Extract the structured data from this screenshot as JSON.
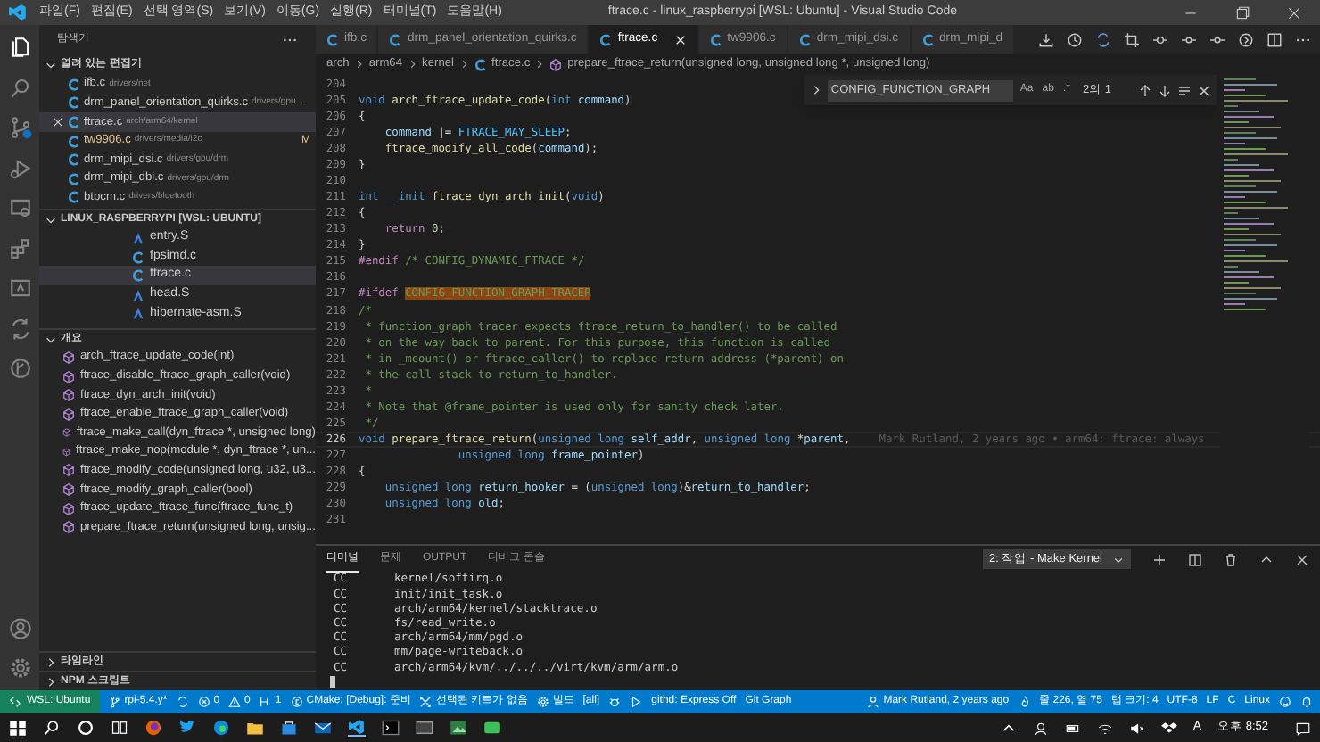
{
  "window": {
    "title": "ftrace.c - linux_raspberrypi [WSL: Ubuntu] - Visual Studio Code"
  },
  "menu": [
    "파일(F)",
    "편집(E)",
    "선택 영역(S)",
    "보기(V)",
    "이동(G)",
    "실행(R)",
    "터미널(T)",
    "도움말(H)"
  ],
  "sidebar": {
    "title": "탐색기",
    "open_editors": {
      "title": "열려 있는 편집기",
      "expanded": true,
      "items": [
        {
          "name": "ifb.c",
          "path": "drivers/net",
          "selected": false,
          "modified": false
        },
        {
          "name": "drm_panel_orientation_quirks.c",
          "path": "drivers/gpu...",
          "selected": false,
          "modified": false
        },
        {
          "name": "ftrace.c",
          "path": "arch/arm64/kernel",
          "selected": true,
          "modified": false
        },
        {
          "name": "tw9906.c",
          "path": "drivers/media/i2c",
          "selected": false,
          "modified": true,
          "badge": "M"
        },
        {
          "name": "drm_mipi_dsi.c",
          "path": "drivers/gpu/drm",
          "selected": false,
          "modified": false
        },
        {
          "name": "drm_mipi_dbi.c",
          "path": "drivers/gpu/drm",
          "selected": false,
          "modified": false
        },
        {
          "name": "btbcm.c",
          "path": "drivers/bluetooth",
          "selected": false,
          "modified": false
        }
      ]
    },
    "project": {
      "title": "LINUX_RASPBERRYPI [WSL: UBUNTU]",
      "expanded": true,
      "items": [
        {
          "name": "entry.S",
          "kind": "asm",
          "selected": false
        },
        {
          "name": "fpsimd.c",
          "kind": "c",
          "selected": false
        },
        {
          "name": "ftrace.c",
          "kind": "c",
          "selected": true
        },
        {
          "name": "head.S",
          "kind": "asm",
          "selected": false
        },
        {
          "name": "hibernate-asm.S",
          "kind": "asm",
          "selected": false
        }
      ]
    },
    "outline": {
      "title": "개요",
      "expanded": true,
      "items": [
        "arch_ftrace_update_code(int)",
        "ftrace_disable_ftrace_graph_caller(void)",
        "ftrace_dyn_arch_init(void)",
        "ftrace_enable_ftrace_graph_caller(void)",
        "ftrace_make_call(dyn_ftrace *, unsigned long)",
        "ftrace_make_nop(module *, dyn_ftrace *, un...",
        "ftrace_modify_code(unsigned long, u32, u3...",
        "ftrace_modify_graph_caller(bool)",
        "ftrace_update_ftrace_func(ftrace_func_t)",
        "prepare_ftrace_return(unsigned long, unsig..."
      ]
    },
    "bottom_sections": [
      {
        "title": "타임라인",
        "expanded": false
      },
      {
        "title": "NPM 스크립트",
        "expanded": false
      }
    ]
  },
  "tabs": [
    {
      "label": "ifb.c",
      "selected": false
    },
    {
      "label": "drm_panel_orientation_quirks.c",
      "selected": false
    },
    {
      "label": "ftrace.c",
      "selected": true
    },
    {
      "label": "tw9906.c",
      "selected": false
    },
    {
      "label": "drm_mipi_dsi.c",
      "selected": false
    },
    {
      "label": "drm_mipi_d",
      "selected": false
    }
  ],
  "breadcrumb": [
    "arch",
    "arm64",
    "kernel",
    "ftrace.c",
    "prepare_ftrace_return(unsigned long, unsigned long *, unsigned long)"
  ],
  "find": {
    "value": "CONFIG_FUNCTION_GRAPH",
    "options": [
      "Aa",
      "ab",
      ".*"
    ],
    "count": "2의 1"
  },
  "code": [
    {
      "no": "204",
      "current": false
    },
    {
      "no": "205",
      "current": false,
      "tokens": [
        {
          "text": "void",
          "kind": "kw"
        },
        {
          "text": " arch_ftrace_update_code",
          "kind": "fn"
        },
        {
          "text": "(",
          "kind": "p"
        },
        {
          "text": "int",
          "kind": "kw"
        },
        {
          "text": " command",
          "kind": "var"
        },
        {
          "text": ")",
          "kind": "p"
        }
      ]
    },
    {
      "no": "206",
      "current": false,
      "tokens": [
        {
          "text": "{",
          "kind": "p"
        }
      ]
    },
    {
      "no": "207",
      "current": false,
      "tokens": [
        {
          "text": "    command",
          "kind": "var"
        },
        {
          "text": " |= ",
          "kind": "p"
        },
        {
          "text": "FTRACE_MAY_SLEEP",
          "kind": "macro"
        },
        {
          "text": ";",
          "kind": "p"
        }
      ]
    },
    {
      "no": "208",
      "current": false,
      "tokens": [
        {
          "text": "    ftrace_modify_all_code",
          "kind": "fn"
        },
        {
          "text": "(",
          "kind": "p"
        },
        {
          "text": "command",
          "kind": "var"
        },
        {
          "text": ");",
          "kind": "p"
        }
      ]
    },
    {
      "no": "209",
      "current": false,
      "tokens": [
        {
          "text": "}",
          "kind": "p"
        }
      ]
    },
    {
      "no": "210",
      "current": false
    },
    {
      "no": "211",
      "current": false,
      "tokens": [
        {
          "text": "int __init",
          "kind": "kw"
        },
        {
          "text": " ftrace_dyn_arch_init",
          "kind": "fn"
        },
        {
          "text": "(",
          "kind": "p"
        },
        {
          "text": "void",
          "kind": "kw"
        },
        {
          "text": ")",
          "kind": "p"
        }
      ]
    },
    {
      "no": "212",
      "current": false,
      "tokens": [
        {
          "text": "{",
          "kind": "p"
        }
      ]
    },
    {
      "no": "213",
      "current": false,
      "tokens": [
        {
          "text": "    return",
          "kind": "pre"
        },
        {
          "text": " 0",
          "kind": "num"
        },
        {
          "text": ";",
          "kind": "p"
        }
      ]
    },
    {
      "no": "214",
      "current": false,
      "tokens": [
        {
          "text": "}",
          "kind": "p"
        }
      ]
    },
    {
      "no": "215",
      "current": false,
      "tokens": [
        {
          "text": "#endif",
          "kind": "pre"
        },
        {
          "text": " /* CONFIG_DYNAMIC_FTRACE */",
          "kind": "com"
        }
      ]
    },
    {
      "no": "216",
      "current": false
    },
    {
      "no": "217",
      "current": false,
      "tokens": [
        {
          "text": "#ifdef ",
          "kind": "pre"
        },
        {
          "text": "CONFIG_FUNCTION_GRAPH_TRACER",
          "kind": "match"
        }
      ]
    },
    {
      "no": "218",
      "current": false,
      "tokens": [
        {
          "text": "/*",
          "kind": "com"
        }
      ]
    },
    {
      "no": "219",
      "current": false,
      "tokens": [
        {
          "text": " * function_graph tracer expects ftrace_return_to_handler() to be called",
          "kind": "com"
        }
      ]
    },
    {
      "no": "220",
      "current": false,
      "tokens": [
        {
          "text": " * on the way back to parent. For this purpose, this function is called",
          "kind": "com"
        }
      ]
    },
    {
      "no": "221",
      "current": false,
      "tokens": [
        {
          "text": " * in _mcount() or ftrace_caller() to replace return address (*parent) on",
          "kind": "com"
        }
      ]
    },
    {
      "no": "222",
      "current": false,
      "tokens": [
        {
          "text": " * the call stack to return_to_handler.",
          "kind": "com"
        }
      ]
    },
    {
      "no": "223",
      "current": false,
      "tokens": [
        {
          "text": " *",
          "kind": "com"
        }
      ]
    },
    {
      "no": "224",
      "current": false,
      "tokens": [
        {
          "text": " * Note that @frame_pointer is used only for sanity check later.",
          "kind": "com"
        }
      ]
    },
    {
      "no": "225",
      "current": false,
      "tokens": [
        {
          "text": " */",
          "kind": "com"
        }
      ]
    },
    {
      "no": "226",
      "current": true,
      "blame": "Mark Rutland, 2 years ago • arm64: ftrace: always",
      "tokens": [
        {
          "text": "void",
          "kind": "kw"
        },
        {
          "text": " prepare_ftrace_return",
          "kind": "fn"
        },
        {
          "text": "(",
          "kind": "p"
        },
        {
          "text": "unsigned long",
          "kind": "kw"
        },
        {
          "text": " self_addr",
          "kind": "var"
        },
        {
          "text": ", ",
          "kind": "p"
        },
        {
          "text": "unsigned long",
          "kind": "kw"
        },
        {
          "text": " *",
          "kind": "p"
        },
        {
          "text": "parent",
          "kind": "var"
        },
        {
          "text": ",",
          "kind": "p"
        }
      ]
    },
    {
      "no": "227",
      "current": false,
      "tokens": [
        {
          "text": "               unsigned long",
          "kind": "kw"
        },
        {
          "text": " frame_pointer",
          "kind": "var"
        },
        {
          "text": ")",
          "kind": "p"
        }
      ]
    },
    {
      "no": "228",
      "current": false,
      "tokens": [
        {
          "text": "{",
          "kind": "p"
        }
      ]
    },
    {
      "no": "229",
      "current": false,
      "tokens": [
        {
          "text": "    unsigned long",
          "kind": "kw"
        },
        {
          "text": " return_hooker",
          "kind": "var"
        },
        {
          "text": " = (",
          "kind": "p"
        },
        {
          "text": "unsigned long",
          "kind": "kw"
        },
        {
          "text": ")&",
          "kind": "p"
        },
        {
          "text": "return_to_handler",
          "kind": "var"
        },
        {
          "text": ";",
          "kind": "p"
        }
      ]
    },
    {
      "no": "230",
      "current": false,
      "tokens": [
        {
          "text": "    unsigned long",
          "kind": "kw"
        },
        {
          "text": " old",
          "kind": "var"
        },
        {
          "text": ";",
          "kind": "p"
        }
      ]
    },
    {
      "no": "231",
      "current": false
    }
  ],
  "panel": {
    "tabs": [
      {
        "label": "터미널",
        "selected": true
      },
      {
        "label": "문제",
        "selected": false
      },
      {
        "label": "OUTPUT",
        "selected": false
      },
      {
        "label": "디버그 콘솔",
        "selected": false
      }
    ],
    "terminal_select": "2: 작업 - Make Kernel",
    "lines": [
      [
        "CC",
        "kernel/softirq.o"
      ],
      [
        "CC",
        "init/init_task.o"
      ],
      [
        "CC",
        "arch/arm64/kernel/stacktrace.o"
      ],
      [
        "CC",
        "fs/read_write.o"
      ],
      [
        "CC",
        "arch/arm64/mm/pgd.o"
      ],
      [
        "CC",
        "mm/page-writeback.o"
      ],
      [
        "CC",
        "arch/arm64/kvm/../../../virt/kvm/arm/arm.o"
      ]
    ]
  },
  "status_bar": {
    "left": [
      {
        "kind": "remote",
        "text": "WSL: Ubuntu"
      },
      {
        "kind": "branch",
        "text": "rpi-5.4.y*"
      },
      {
        "kind": "sync"
      },
      {
        "kind": "errors",
        "text": "0"
      },
      {
        "kind": "warnings",
        "text": "0"
      },
      {
        "kind": "share",
        "text": "1"
      },
      {
        "kind": "cmake",
        "text": "CMake: [Debug]: 준비"
      },
      {
        "kind": "kit",
        "text": "선택된 키트가 없음"
      },
      {
        "kind": "build",
        "text": "빌드"
      },
      {
        "kind": "plain",
        "text": "[all]"
      },
      {
        "kind": "debug"
      },
      {
        "kind": "run"
      },
      {
        "kind": "plain",
        "text": "githd: Express Off"
      },
      {
        "kind": "plain",
        "text": "Git Graph"
      }
    ],
    "right": [
      {
        "kind": "blame",
        "text": "Mark Rutland, 2 years ago"
      },
      {
        "kind": "flame"
      },
      {
        "kind": "plain",
        "text": "줄 226, 열 75"
      },
      {
        "kind": "plain",
        "text": "탭 크기: 4"
      },
      {
        "kind": "plain",
        "text": "UTF-8"
      },
      {
        "kind": "plain",
        "text": "LF"
      },
      {
        "kind": "plain",
        "text": "C"
      },
      {
        "kind": "plain",
        "text": "Linux"
      },
      {
        "kind": "feedback"
      },
      {
        "kind": "bell"
      }
    ]
  },
  "taskbar": {
    "ime": "A",
    "clock": "오후 8:52"
  }
}
